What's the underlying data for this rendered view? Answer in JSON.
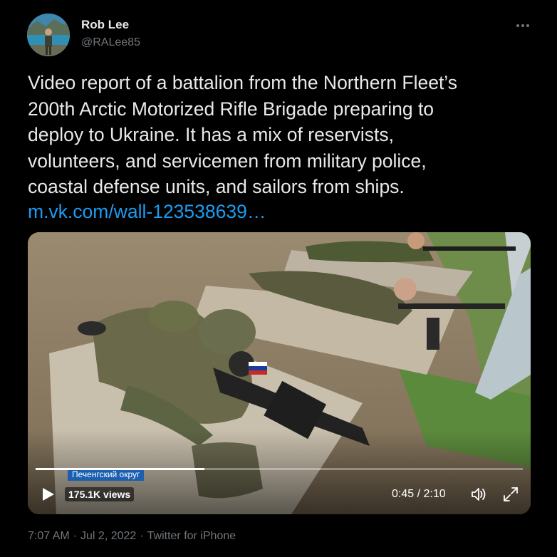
{
  "author": {
    "name": "Rob Lee",
    "handle": "@RALee85",
    "avatar_icon": "profile-photo"
  },
  "tweet": {
    "text": "Video report of a battalion from the Northern Fleet’s\n200th Arctic Motorized Rifle Brigade preparing to\ndeploy to Ukraine. It has a mix of reservists,\nvolunteers, and servicemen from military police,\ncoastal defense units, and sailors from ships.",
    "link_text": "m.vk.com/wall-123538639…"
  },
  "video": {
    "caption": "Печенгский округ",
    "views": "175.1K views",
    "time": "0:45 / 2:10",
    "progress": 0.346,
    "icons": {
      "play": "play-icon",
      "volume": "volume-icon",
      "fullscreen": "fullscreen-icon"
    }
  },
  "meta": {
    "time": "7:07 AM",
    "separator": "·",
    "date": "Jul 2, 2022",
    "source": "Twitter for iPhone"
  },
  "colors": {
    "background": "#000000",
    "text": "#e7e9ea",
    "secondary": "#71767b",
    "link": "#1d9bf0",
    "caption_bg": "#1a5fb0"
  }
}
